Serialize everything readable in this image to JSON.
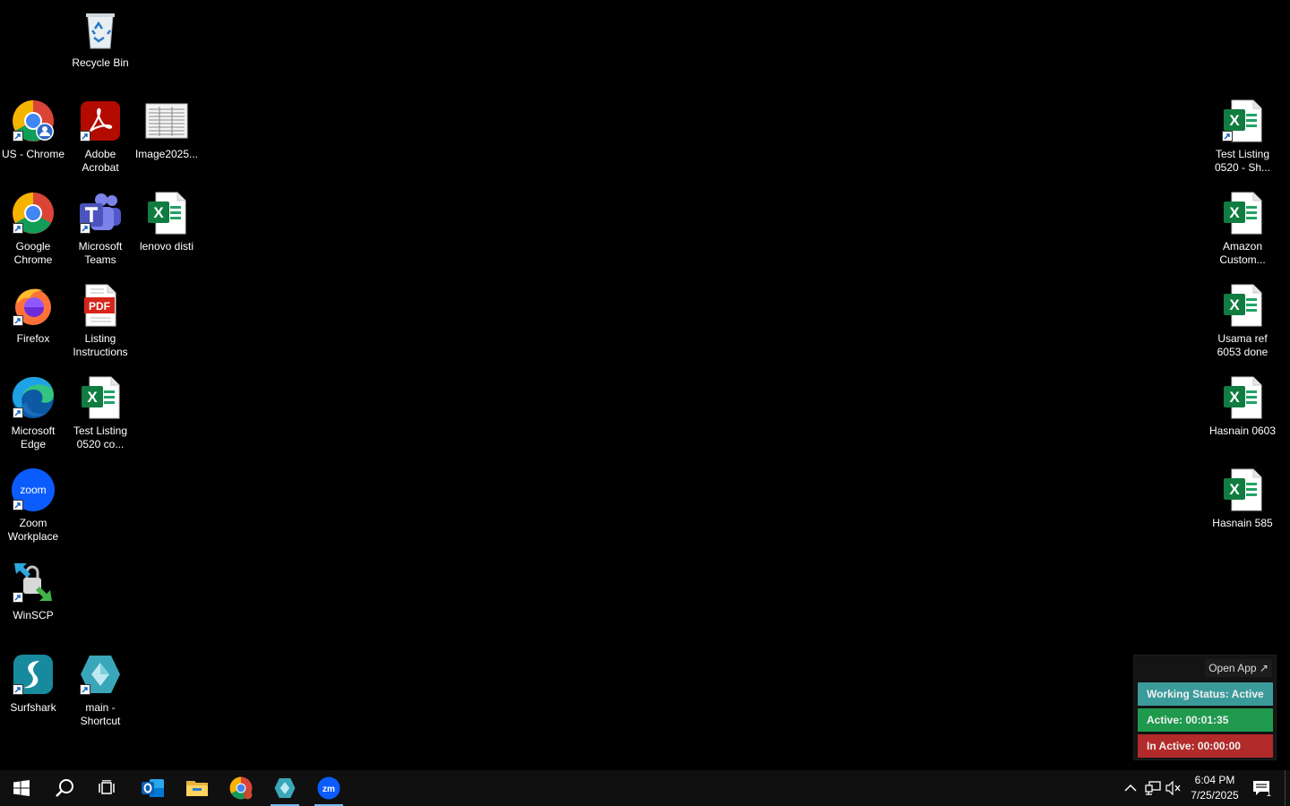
{
  "desktop": {
    "left_icons": [
      {
        "label": "Recycle Bin",
        "icon": "recycle-bin-icon"
      },
      {
        "label": "US - Chrome",
        "icon": "chrome-profile-icon"
      },
      {
        "label": "Adobe Acrobat",
        "icon": "adobe-acrobat-icon"
      },
      {
        "label": "Image2025...",
        "icon": "image-thumbnail-icon"
      },
      {
        "label": "Google Chrome",
        "icon": "chrome-icon"
      },
      {
        "label": "Microsoft Teams",
        "icon": "teams-icon"
      },
      {
        "label": "lenovo disti",
        "icon": "excel-file-icon"
      },
      {
        "label": "Firefox",
        "icon": "firefox-icon"
      },
      {
        "label": "Listing Instructions",
        "icon": "pdf-file-icon"
      },
      {
        "label": "Microsoft Edge",
        "icon": "edge-icon"
      },
      {
        "label": "Test Listing 0520 co...",
        "icon": "excel-file-icon"
      },
      {
        "label": "Zoom Workplace",
        "icon": "zoom-icon"
      },
      {
        "label": "WinSCP",
        "icon": "winscp-icon"
      },
      {
        "label": "Surfshark",
        "icon": "surfshark-icon"
      },
      {
        "label": "main - Shortcut",
        "icon": "app-diamond-icon"
      }
    ],
    "right_icons": [
      {
        "label": "Test Listing 0520 - Sh...",
        "icon": "excel-file-icon"
      },
      {
        "label": "Amazon Custom...",
        "icon": "excel-file-icon"
      },
      {
        "label": "Usama ref 6053 done",
        "icon": "excel-file-icon"
      },
      {
        "label": "Hasnain 0603",
        "icon": "excel-file-icon"
      },
      {
        "label": "Hasnain 585",
        "icon": "excel-file-icon"
      }
    ],
    "pdf_badge": "PDF",
    "excel_letter": "X",
    "zoom_badge": "zoom"
  },
  "widget": {
    "open_app": "Open App ↗",
    "working_status": "Working Status: Active",
    "active": "Active: 00:01:35",
    "inactive": "In Active: 00:00:00",
    "colors": {
      "status": "#3b9b9b",
      "active": "#1f9a4d",
      "inactive": "#b22a2a"
    }
  },
  "taskbar": {
    "pinned": [
      "start-icon",
      "search-icon",
      "task-view-icon",
      "outlook-icon",
      "file-explorer-icon",
      "chrome-icon",
      "app-diamond-icon",
      "zoom-icon"
    ],
    "zoom_label": "zm",
    "time": "6:04 PM",
    "date": "7/25/2025",
    "notification_count": "1"
  }
}
